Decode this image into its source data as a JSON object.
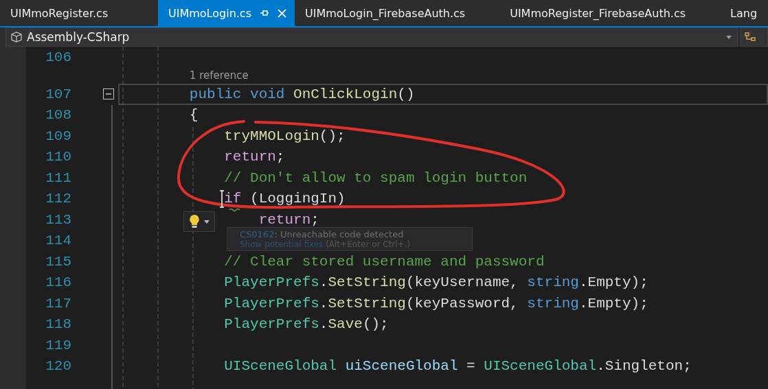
{
  "tabs": [
    {
      "label": "UIMmoRegister.cs",
      "selected": false,
      "pinned": false
    },
    {
      "label": "UIMmoLogin.cs",
      "selected": true,
      "pinned": true
    },
    {
      "label": "UIMmoLogin_FirebaseAuth.cs",
      "selected": false,
      "pinned": false
    },
    {
      "label": "UIMmoRegister_FirebaseAuth.cs",
      "selected": false,
      "pinned": false
    },
    {
      "label": "Lang",
      "selected": false,
      "pinned": false
    }
  ],
  "navigation_bar": {
    "project": "Assembly-CSharp"
  },
  "editor": {
    "rows": [
      {
        "kind": "line",
        "number": "106",
        "indent": "",
        "tokens": []
      },
      {
        "kind": "codelens",
        "text": "1 reference",
        "indent": "        "
      },
      {
        "kind": "line",
        "number": "107",
        "indent": "        ",
        "current": true,
        "foldable": true,
        "tokens": [
          {
            "text": "public void",
            "kind": "keyword"
          },
          {
            "text": " OnClickLogin",
            "kind": "method"
          },
          {
            "text": "()",
            "kind": "plain"
          }
        ]
      },
      {
        "kind": "line",
        "number": "108",
        "indent": "        ",
        "tokens": [
          {
            "text": "{",
            "kind": "plain"
          }
        ]
      },
      {
        "kind": "line",
        "number": "109",
        "indent": "            ",
        "tokens": [
          {
            "text": "tryMMOLogin",
            "kind": "method"
          },
          {
            "text": "();",
            "kind": "plain"
          }
        ]
      },
      {
        "kind": "line",
        "number": "110",
        "indent": "            ",
        "tokens": [
          {
            "text": "return",
            "kind": "control"
          },
          {
            "text": ";",
            "kind": "plain"
          }
        ]
      },
      {
        "kind": "line",
        "number": "111",
        "indent": "            ",
        "tokens": [
          {
            "text": "// Don't allow to spam login button",
            "kind": "comment"
          }
        ]
      },
      {
        "kind": "line",
        "number": "112",
        "indent": "            ",
        "tokens": [
          {
            "text": "if",
            "kind": "control"
          },
          {
            "text": " (LoggingIn)",
            "kind": "plain"
          }
        ]
      },
      {
        "kind": "line",
        "number": "113",
        "indent": "                ",
        "tokens": [
          {
            "text": "return",
            "kind": "control"
          },
          {
            "text": ";",
            "kind": "plain"
          }
        ]
      },
      {
        "kind": "line",
        "number": "114",
        "indent": "",
        "tokens": []
      },
      {
        "kind": "line",
        "number": "115",
        "indent": "            ",
        "tokens": [
          {
            "text": "// Clear stored username and password",
            "kind": "comment"
          }
        ]
      },
      {
        "kind": "line",
        "number": "116",
        "indent": "            ",
        "tokens": [
          {
            "text": "PlayerPrefs",
            "kind": "type"
          },
          {
            "text": ".",
            "kind": "plain"
          },
          {
            "text": "SetString",
            "kind": "method"
          },
          {
            "text": "(keyUsername, ",
            "kind": "plain"
          },
          {
            "text": "string",
            "kind": "keyword"
          },
          {
            "text": ".Empty);",
            "kind": "plain"
          }
        ]
      },
      {
        "kind": "line",
        "number": "117",
        "indent": "            ",
        "tokens": [
          {
            "text": "PlayerPrefs",
            "kind": "type"
          },
          {
            "text": ".",
            "kind": "plain"
          },
          {
            "text": "SetString",
            "kind": "method"
          },
          {
            "text": "(keyPassword, ",
            "kind": "plain"
          },
          {
            "text": "string",
            "kind": "keyword"
          },
          {
            "text": ".Empty);",
            "kind": "plain"
          }
        ]
      },
      {
        "kind": "line",
        "number": "118",
        "indent": "            ",
        "tokens": [
          {
            "text": "PlayerPrefs",
            "kind": "type"
          },
          {
            "text": ".",
            "kind": "plain"
          },
          {
            "text": "Save",
            "kind": "method"
          },
          {
            "text": "();",
            "kind": "plain"
          }
        ]
      },
      {
        "kind": "line",
        "number": "119",
        "indent": "",
        "tokens": []
      },
      {
        "kind": "line",
        "number": "120",
        "indent": "            ",
        "tokens": [
          {
            "text": "UISceneGlobal",
            "kind": "type"
          },
          {
            "text": " uiSceneGlobal",
            "kind": "variable"
          },
          {
            "text": " = ",
            "kind": "plain"
          },
          {
            "text": "UISceneGlobal",
            "kind": "type"
          },
          {
            "text": ".Singleton;",
            "kind": "plain"
          }
        ]
      }
    ]
  },
  "quick_info": {
    "code": "CS0162",
    "message": ": Unreachable code detected",
    "action": "Show potential fixes",
    "shortcut": "(Alt+Enter or Ctrl+.)"
  }
}
